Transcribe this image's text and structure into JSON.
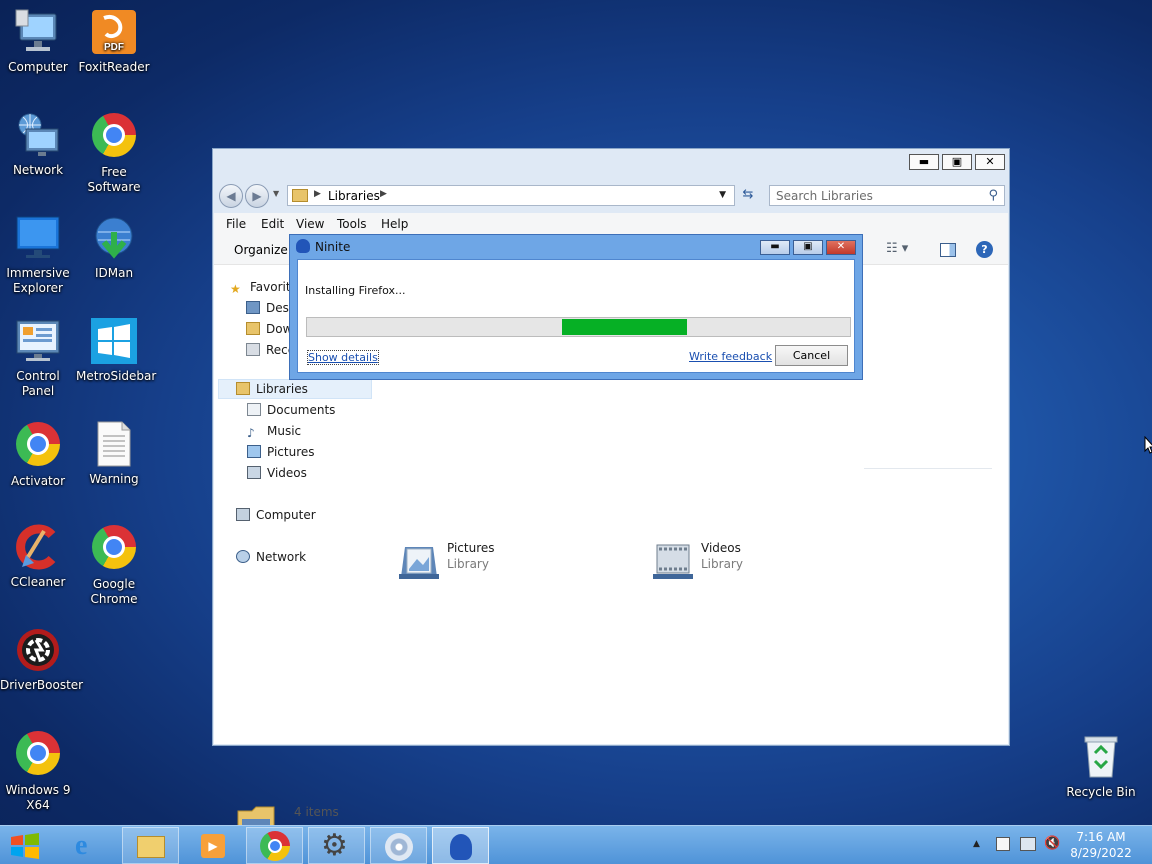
{
  "desktop": {
    "icons": [
      {
        "label": "Computer",
        "icon": "computer-icon"
      },
      {
        "label": "FoxitReader",
        "icon": "pdf-icon",
        "badge": "PDF"
      },
      {
        "label": "Network",
        "icon": "network-icon"
      },
      {
        "label": "Free Software",
        "icon": "chrome-icon"
      },
      {
        "label": "Immersive Explorer",
        "icon": "monitor-icon"
      },
      {
        "label": "IDMan",
        "icon": "idm-icon"
      },
      {
        "label": "Control Panel",
        "icon": "control-panel-icon"
      },
      {
        "label": "MetroSidebar",
        "icon": "windows-icon"
      },
      {
        "label": "Activator",
        "icon": "chrome-icon"
      },
      {
        "label": "Warning",
        "icon": "document-icon"
      },
      {
        "label": "CCleaner",
        "icon": "ccleaner-icon"
      },
      {
        "label": "Google Chrome",
        "icon": "chrome-icon"
      },
      {
        "label": "DriverBooster",
        "icon": "gear-icon"
      },
      {
        "label": "Windows 9 X64",
        "icon": "chrome-icon"
      },
      {
        "label": "Recycle Bin",
        "icon": "recycle-bin-icon"
      }
    ]
  },
  "explorer": {
    "controls": {
      "minimize": "▬",
      "maximize": "▣",
      "close": "✕"
    },
    "breadcrumb": "Libraries",
    "search_placeholder": "Search Libraries",
    "menu": [
      "File",
      "Edit",
      "View",
      "Tools",
      "Help"
    ],
    "toolbar": {
      "organize": "Organize"
    },
    "nav": {
      "favorites": [
        "Favorites",
        "Desktop",
        "Downloads",
        "Recent Places"
      ],
      "libraries": [
        "Libraries",
        "Documents",
        "Music",
        "Pictures",
        "Videos"
      ],
      "computer": "Computer",
      "network": "Network"
    },
    "libraries": [
      {
        "name": "Pictures",
        "type": "Library"
      },
      {
        "name": "Videos",
        "type": "Library"
      }
    ],
    "status": "4 items"
  },
  "ninite": {
    "title": "Ninite",
    "status": "Installing Firefox...",
    "progress_segment": {
      "start": 0.47,
      "end": 0.7
    },
    "show_details": "Show details",
    "write_feedback": "Write feedback",
    "cancel": "Cancel"
  },
  "taskbar": {
    "time": "7:16 AM",
    "date": "8/29/2022",
    "tray_arrow": "▲"
  },
  "colors": {
    "progress": "#06b025",
    "ninite_frame": "#6ea6e6",
    "taskbar": "#5d9fe0"
  }
}
